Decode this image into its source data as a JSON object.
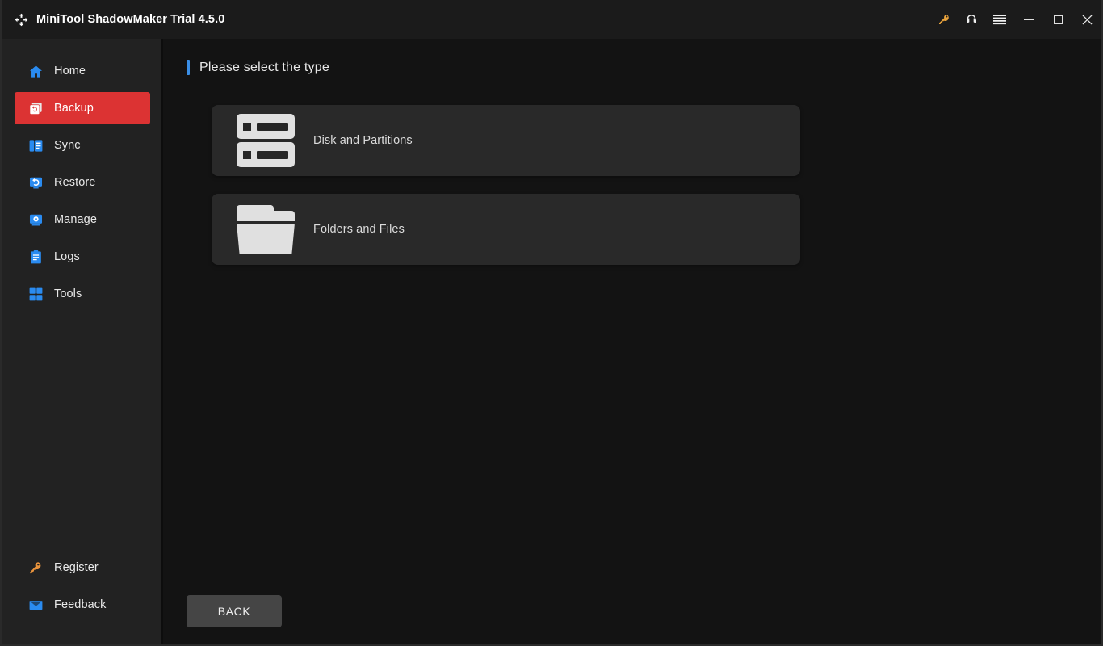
{
  "window": {
    "title": "MiniTool ShadowMaker Trial 4.5.0",
    "logo_icon": "sync-arrows-icon"
  },
  "titlebar": {
    "actions": [
      {
        "name": "key-icon",
        "label": "Register",
        "color": "#e9a33c"
      },
      {
        "name": "headset-icon",
        "label": "Support",
        "color": "#ffffff"
      },
      {
        "name": "hamburger-menu-icon",
        "label": "Menu",
        "color": "#ffffff"
      }
    ],
    "system": [
      {
        "name": "minimize-button",
        "label": "Minimize"
      },
      {
        "name": "maximize-button",
        "label": "Maximize"
      },
      {
        "name": "close-button",
        "label": "Close",
        "glyph": "✕"
      }
    ]
  },
  "sidebar": {
    "items": [
      {
        "label": "Home",
        "icon": "home-icon",
        "active": false
      },
      {
        "label": "Backup",
        "icon": "backup-icon",
        "active": true
      },
      {
        "label": "Sync",
        "icon": "sync-icon",
        "active": false
      },
      {
        "label": "Restore",
        "icon": "restore-icon",
        "active": false
      },
      {
        "label": "Manage",
        "icon": "manage-icon",
        "active": false
      },
      {
        "label": "Logs",
        "icon": "logs-icon",
        "active": false
      },
      {
        "label": "Tools",
        "icon": "tools-icon",
        "active": false
      }
    ],
    "bottom_items": [
      {
        "label": "Register",
        "icon": "key-icon"
      },
      {
        "label": "Feedback",
        "icon": "envelope-icon"
      }
    ],
    "active_color": "#dc3333",
    "icon_color": "#2a8bf0"
  },
  "main": {
    "heading": "Please select the type",
    "accent_color": "#3a8ee6",
    "cards": [
      {
        "label": "Disk and Partitions",
        "icon": "disk-icon"
      },
      {
        "label": "Folders and Files",
        "icon": "folder-icon"
      }
    ]
  },
  "footer": {
    "back_label": "BACK"
  }
}
